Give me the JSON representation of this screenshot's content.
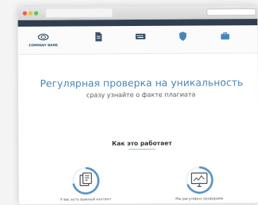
{
  "browser": {
    "tab_title": "",
    "url": ""
  },
  "topstrip": {
    "links": [
      "",
      ""
    ]
  },
  "nav": {
    "logo_text": "COMPANY NAME",
    "items": [
      {
        "label": "",
        "icon": "document-icon"
      },
      {
        "label": "",
        "icon": "keyboard-icon"
      },
      {
        "label": "",
        "icon": "shield-icon"
      },
      {
        "label": "",
        "icon": "briefcase-icon"
      }
    ]
  },
  "hero": {
    "title": "Регулярная проверка на уникальность",
    "subtitle": "сразу узнайте о факте плагиата"
  },
  "how": {
    "title": "Как это работает",
    "steps": [
      {
        "label": "У вас есть важный контент",
        "icon": "document-stack-icon"
      },
      {
        "label": "Мы регулярно проверяем",
        "icon": "monitor-chart-icon"
      }
    ]
  },
  "colors": {
    "accent": "#4b86ba",
    "nav_text": "#4b5c6f",
    "strip": "#2f3f51"
  }
}
